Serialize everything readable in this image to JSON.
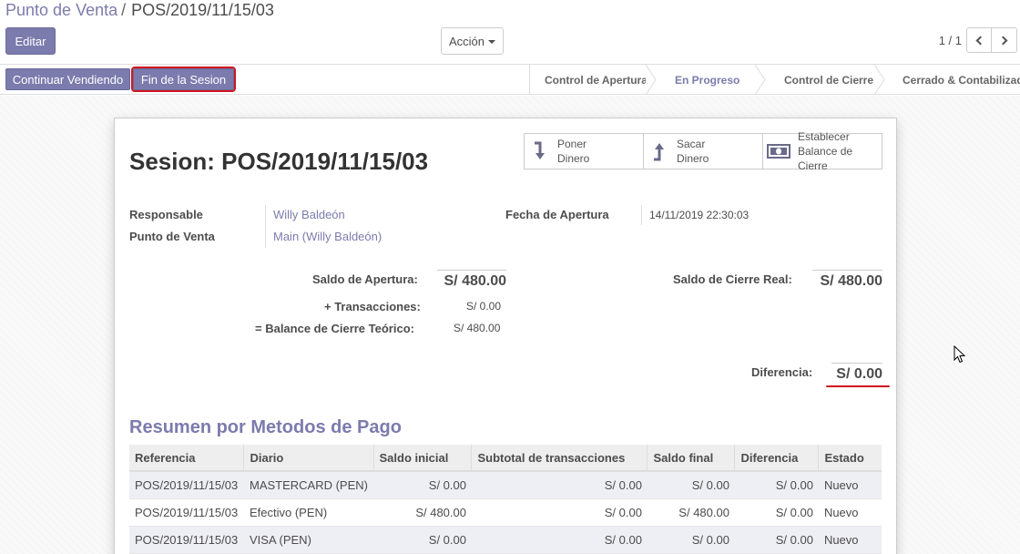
{
  "breadcrumb": {
    "parent": "Punto de Venta",
    "separator": "/",
    "current": "POS/2019/11/15/03"
  },
  "toolbar": {
    "edit_label": "Editar",
    "action_label": "Acción",
    "pager": "1 / 1"
  },
  "statusbar": {
    "continue_label": "Continuar Vendiendo",
    "end_session_label": "Fin de la Sesion",
    "stages": [
      {
        "label": "Control de Apertura",
        "active": false
      },
      {
        "label": "En Progreso",
        "active": true
      },
      {
        "label": "Control de Cierre",
        "active": false
      },
      {
        "label": "Cerrado & Contabilizado",
        "active": false
      }
    ]
  },
  "sheet": {
    "title": "Sesion: POS/2019/11/15/03",
    "stat_buttons": [
      {
        "label": "Poner\nDinero",
        "icon": "level-down-icon"
      },
      {
        "label": "Sacar\nDinero",
        "icon": "level-up-icon"
      },
      {
        "label": "Establecer\nBalance de\nCierre",
        "icon": "money-icon"
      }
    ],
    "fields": {
      "responsable_label": "Responsable",
      "responsable_value": "Willy Baldeón",
      "pos_label": "Punto de Venta",
      "pos_value": "Main (Willy Baldeón)",
      "fecha_label": "Fecha de Apertura",
      "fecha_value": "14/11/2019 22:30:03"
    },
    "balances": {
      "saldo_apertura_label": "Saldo de Apertura:",
      "saldo_apertura_value": "S/ 480.00",
      "transacciones_label": "+ Transacciones:",
      "transacciones_value": "S/ 0.00",
      "teorico_label": "= Balance de Cierre Teórico:",
      "teorico_value": "S/ 480.00",
      "cierre_real_label": "Saldo de Cierre Real:",
      "cierre_real_value": "S/ 480.00",
      "diferencia_label": "Diferencia:",
      "diferencia_value": "S/ 0.00"
    },
    "payment_summary": {
      "title": "Resumen por Metodos de Pago",
      "columns": [
        "Referencia",
        "Diario",
        "Saldo inicial",
        "Subtotal de transacciones",
        "Saldo final",
        "Diferencia",
        "Estado"
      ],
      "rows": [
        [
          "POS/2019/11/15/03",
          "MASTERCARD (PEN)",
          "S/ 0.00",
          "S/ 0.00",
          "S/ 0.00",
          "S/ 0.00",
          "Nuevo"
        ],
        [
          "POS/2019/11/15/03",
          "Efectivo (PEN)",
          "S/ 480.00",
          "S/ 0.00",
          "S/ 480.00",
          "S/ 0.00",
          "Nuevo"
        ],
        [
          "POS/2019/11/15/03",
          "VISA (PEN)",
          "S/ 0.00",
          "S/ 0.00",
          "S/ 0.00",
          "S/ 0.00",
          "Nuevo"
        ]
      ]
    }
  },
  "colors": {
    "brand": "#7c7bad",
    "highlight_red": "#d0161f"
  }
}
